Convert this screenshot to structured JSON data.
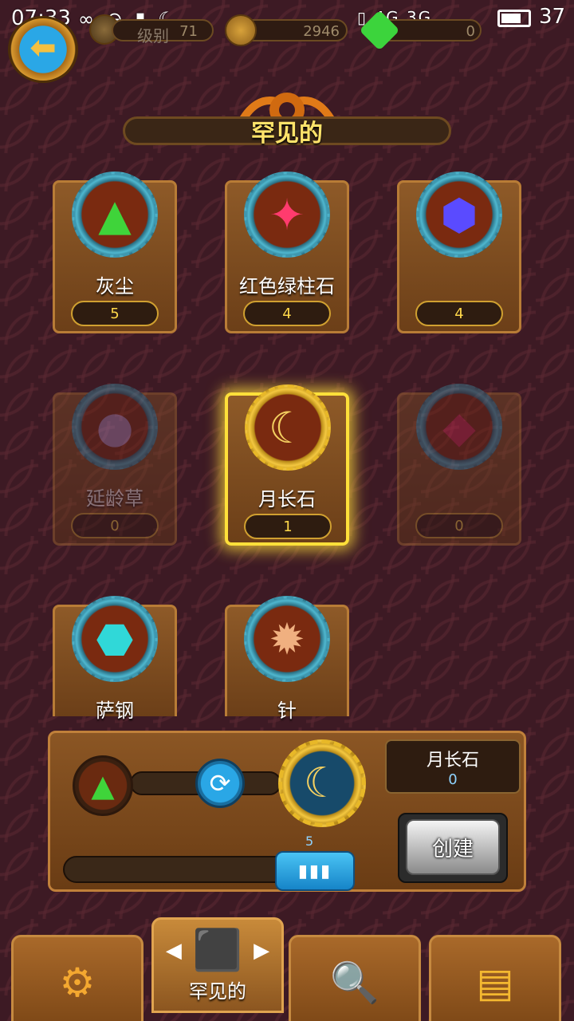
{
  "status_bar": {
    "time": "07:33",
    "left_icons": "∞ ⊖ ▮ ☾",
    "right_icons": "▯ 4G 3G",
    "battery": "37"
  },
  "resources": {
    "level_label": "级别",
    "level_value": "71",
    "coins": "2946",
    "gems": "0"
  },
  "header": {
    "title": "罕见的"
  },
  "items": [
    {
      "name": "灰尘",
      "count": "5",
      "icon": "green-dust-pile",
      "symbol": "▲",
      "color": "#3fd43a",
      "state": "normal"
    },
    {
      "name": "红色绿柱石",
      "count": "4",
      "icon": "red-crystal-cluster",
      "symbol": "✦",
      "color": "#ff3b6e",
      "state": "normal"
    },
    {
      "name": "",
      "count": "4",
      "icon": "blue-crystal-ore",
      "symbol": "⬢",
      "color": "#5a4bff",
      "state": "normal"
    },
    {
      "name": "延龄草",
      "count": "0",
      "icon": "purple-bubble",
      "symbol": "●",
      "color": "#b08bc0",
      "state": "dim"
    },
    {
      "name": "月长石",
      "count": "1",
      "icon": "moonstone-claw",
      "symbol": "☾",
      "color": "#f4d060",
      "state": "selected"
    },
    {
      "name": "",
      "count": "0",
      "icon": "ruby-gem",
      "symbol": "◆",
      "color": "#d02850",
      "state": "dim"
    },
    {
      "name": "萨钢",
      "count": "",
      "icon": "cyan-crystal-ore",
      "symbol": "⬣",
      "color": "#30d8d8",
      "state": "cut"
    },
    {
      "name": "针",
      "count": "",
      "icon": "spiky-seed",
      "symbol": "✹",
      "color": "#f0b080",
      "state": "cut"
    }
  ],
  "crafting": {
    "source_icon": "green-dust-pile",
    "source_symbol": "▲",
    "swap_symbol": "⟳",
    "result_icon": "moonstone-claw",
    "result_symbol": "☾",
    "result_name": "月长石",
    "result_count": "0",
    "quantity": "5",
    "slider_fraction": 1.0,
    "slider_handle": "▮▮▮",
    "create_label": "创建"
  },
  "bottom_tabs": [
    {
      "icon": "gear-icon",
      "symbol": "⚙",
      "label": ""
    },
    {
      "icon": "dice-icon",
      "symbol": "⬛",
      "label": "罕见的",
      "active": true,
      "left_arrow": "◀",
      "right_arrow": "▶"
    },
    {
      "icon": "magnifier-icon",
      "symbol": "🔍",
      "label": ""
    },
    {
      "icon": "chest-icon",
      "symbol": "▤",
      "label": ""
    }
  ]
}
